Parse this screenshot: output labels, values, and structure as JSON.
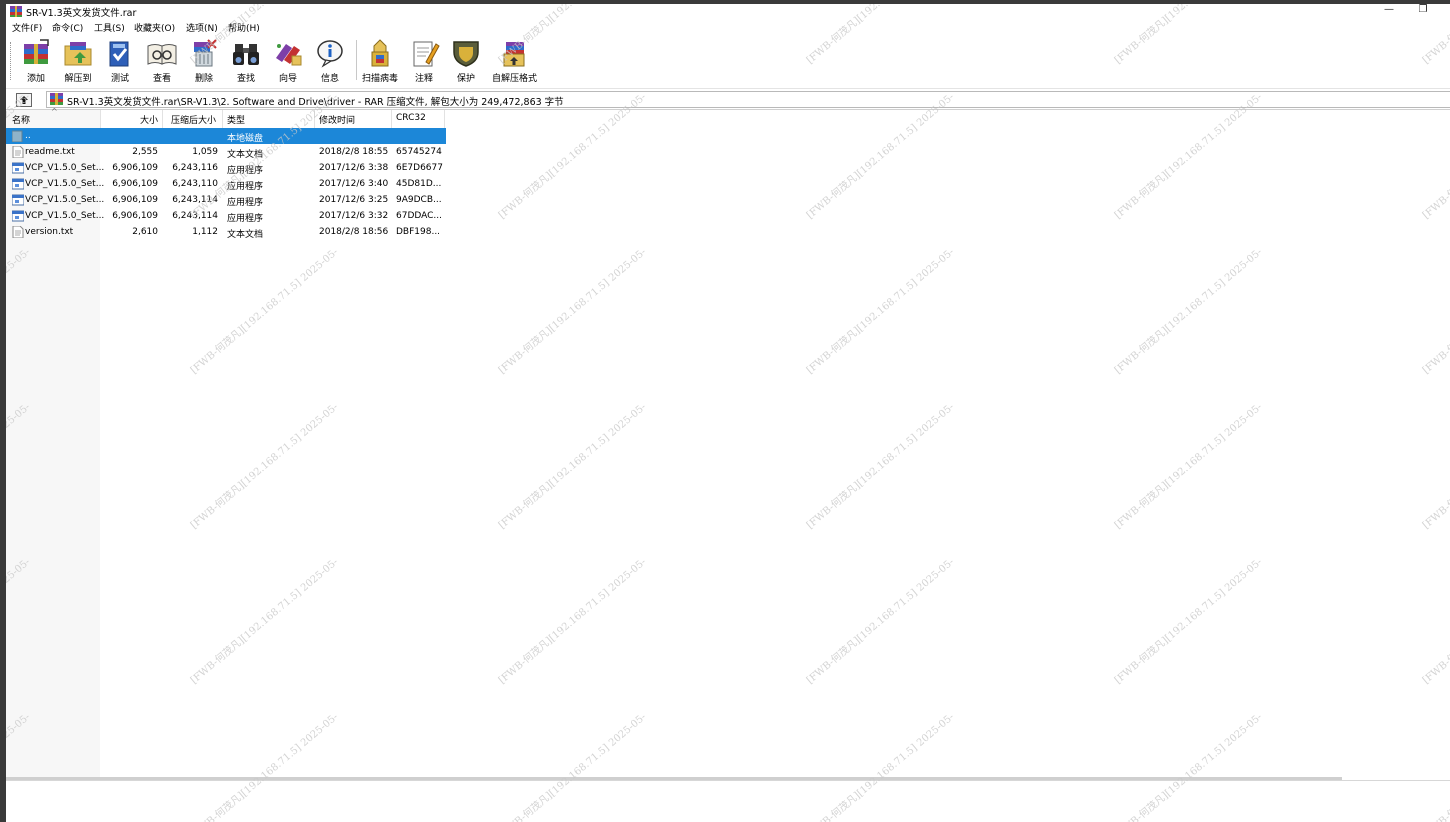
{
  "window": {
    "title": "SR-V1.3英文发货文件.rar",
    "minimize_glyph": "—",
    "restore_glyph": "❐"
  },
  "menu": [
    {
      "label": "文件(F)"
    },
    {
      "label": "命令(C)"
    },
    {
      "label": "工具(S)"
    },
    {
      "label": "收藏夹(O)"
    },
    {
      "label": "选项(N)"
    },
    {
      "label": "帮助(H)"
    }
  ],
  "toolbar": {
    "buttons": [
      {
        "label": "添加",
        "icon": "add-archive-icon"
      },
      {
        "label": "解压到",
        "icon": "extract-to-icon"
      },
      {
        "label": "测试",
        "icon": "test-icon"
      },
      {
        "label": "查看",
        "icon": "view-icon"
      },
      {
        "label": "删除",
        "icon": "delete-icon"
      },
      {
        "label": "查找",
        "icon": "find-binoculars-icon"
      },
      {
        "label": "向导",
        "icon": "wizard-icon"
      },
      {
        "label": "信息",
        "icon": "info-icon"
      },
      {
        "label": "扫描病毒",
        "icon": "virus-scan-icon"
      },
      {
        "label": "注释",
        "icon": "comment-icon"
      },
      {
        "label": "保护",
        "icon": "protect-shield-icon"
      },
      {
        "label": "自解压格式",
        "icon": "sfx-icon"
      }
    ]
  },
  "address": {
    "path": "SR-V1.3英文发货文件.rar\\SR-V1.3\\2. Software and Drive\\driver - RAR 压缩文件, 解包大小为 249,472,863 字节"
  },
  "columns": {
    "name": "名称",
    "size": "大小",
    "packed": "压缩后大小",
    "type": "类型",
    "modified": "修改时间",
    "crc": "CRC32"
  },
  "files": [
    {
      "name": "..",
      "size": "",
      "packed": "",
      "type": "本地磁盘",
      "modified": "",
      "crc": "",
      "selected": true,
      "kind": "folder"
    },
    {
      "name": "readme.txt",
      "size": "2,555",
      "packed": "1,059",
      "type": "文本文档",
      "modified": "2018/2/8 18:55",
      "crc": "65745274",
      "kind": "text"
    },
    {
      "name": "VCP_V1.5.0_Set...",
      "size": "6,906,109",
      "packed": "6,243,116",
      "type": "应用程序",
      "modified": "2017/12/6 3:38",
      "crc": "6E7D6677",
      "kind": "exe"
    },
    {
      "name": "VCP_V1.5.0_Set...",
      "size": "6,906,109",
      "packed": "6,243,110",
      "type": "应用程序",
      "modified": "2017/12/6 3:40",
      "crc": "45D81D...",
      "kind": "exe"
    },
    {
      "name": "VCP_V1.5.0_Set...",
      "size": "6,906,109",
      "packed": "6,243,114",
      "type": "应用程序",
      "modified": "2017/12/6 3:25",
      "crc": "9A9DCB...",
      "kind": "exe"
    },
    {
      "name": "VCP_V1.5.0_Set...",
      "size": "6,906,109",
      "packed": "6,243,114",
      "type": "应用程序",
      "modified": "2017/12/6 3:32",
      "crc": "67DDAC...",
      "kind": "exe"
    },
    {
      "name": "version.txt",
      "size": "2,610",
      "packed": "1,112",
      "type": "文本文档",
      "modified": "2018/2/8 18:56",
      "crc": "DBF198...",
      "kind": "text"
    }
  ],
  "watermark": {
    "text": "[FWB-何茂凡][192.168.71.5] 2025-05-"
  },
  "colors": {
    "selection": "#1c87d8",
    "watermark": "#c8c8c8"
  }
}
